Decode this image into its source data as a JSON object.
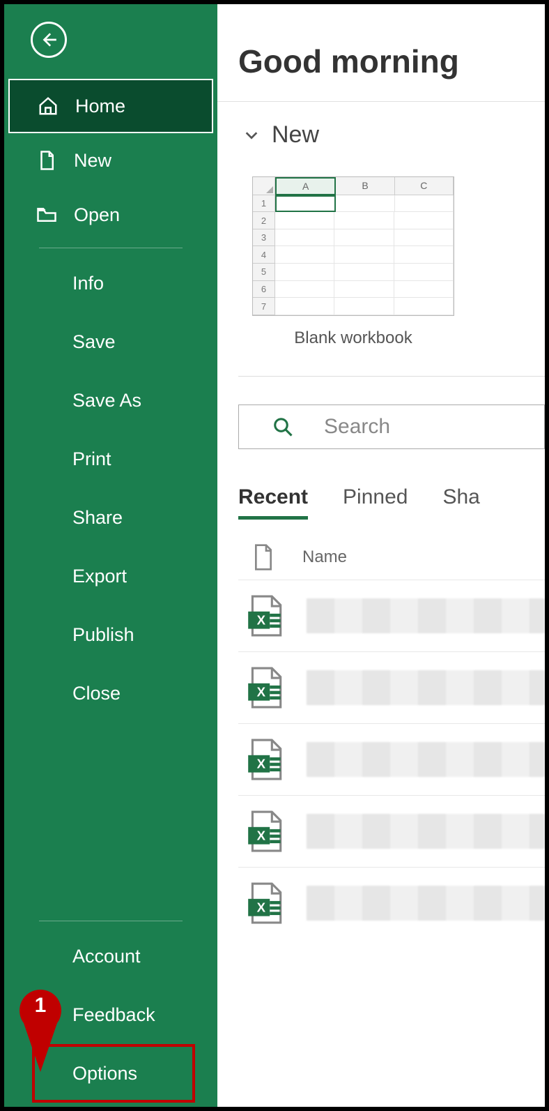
{
  "sidebar": {
    "home": "Home",
    "new": "New",
    "open": "Open",
    "info": "Info",
    "save": "Save",
    "saveAs": "Save As",
    "print": "Print",
    "share": "Share",
    "export": "Export",
    "publish": "Publish",
    "close": "Close",
    "account": "Account",
    "feedback": "Feedback",
    "options": "Options"
  },
  "main": {
    "greeting": "Good morning",
    "newSection": "New",
    "templateLabel": "Blank workbook",
    "searchPlaceholder": "Search",
    "tabs": {
      "recent": "Recent",
      "pinned": "Pinned",
      "shared": "Sha"
    },
    "listHeaderName": "Name",
    "sheetCols": [
      "A",
      "B",
      "C"
    ],
    "sheetRows": [
      "1",
      "2",
      "3",
      "4",
      "5",
      "6",
      "7"
    ]
  },
  "annotation": {
    "marker": "1"
  }
}
